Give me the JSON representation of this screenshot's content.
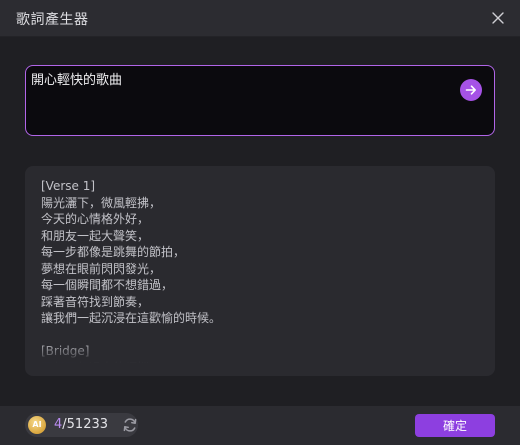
{
  "dialog": {
    "title": "歌詞產生器"
  },
  "prompt": {
    "value": "開心輕快的歌曲"
  },
  "lyrics": {
    "text": "[Verse 1]\n陽光灑下，微風輕拂，\n今天的心情格外好，\n和朋友一起大聲笑，\n每一步都像是跳舞的節拍，\n夢想在眼前閃閃發光，\n每一個瞬間都不想錯過，\n踩著音符找到節奏，\n讓我們一起沉浸在這歡愉的時候。\n\n[Bridge]\n不想再想過去的煩惱"
  },
  "footer": {
    "ai_badge": "AI",
    "credits_used": "4",
    "credits_total": "/51233",
    "confirm_label": "確定"
  },
  "icons": {
    "close": "close-icon",
    "send": "arrow-right-icon",
    "refresh": "refresh-icon",
    "ai_coin": "ai-coin-icon"
  },
  "colors": {
    "accent": "#a652e6",
    "prompt_border": "#b165e8",
    "confirm_button": "#8d3fe0",
    "coin": "#d9a63e"
  }
}
